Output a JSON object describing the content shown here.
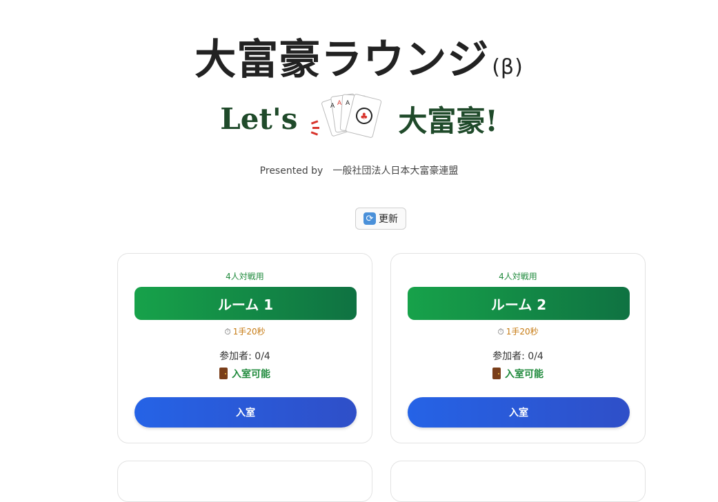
{
  "header": {
    "title": "大富豪ラウンジ",
    "beta": "(β)",
    "logo_left": "Let's",
    "logo_right": "大富豪!",
    "presented_by": "Presented by",
    "organization": "一般社団法人日本大富豪連盟"
  },
  "toolbar": {
    "refresh_icon": "refresh-icon",
    "refresh_label": "更新"
  },
  "rooms": [
    {
      "mode": "4人対戦用",
      "name": "ルーム 1",
      "timer_icon": "stopwatch-icon",
      "time_limit": "1手20秒",
      "players": "参加者: 0/4",
      "status_icon": "door-icon",
      "status": "入室可能",
      "enter_label": "入室"
    },
    {
      "mode": "4人対戦用",
      "name": "ルーム 2",
      "timer_icon": "stopwatch-icon",
      "time_limit": "1手20秒",
      "players": "参加者: 0/4",
      "status_icon": "door-icon",
      "status": "入室可能",
      "enter_label": "入室"
    }
  ],
  "colors": {
    "accent_green": "#17a24a",
    "enter_blue": "#2563e6",
    "timer_orange": "#c67a12"
  }
}
